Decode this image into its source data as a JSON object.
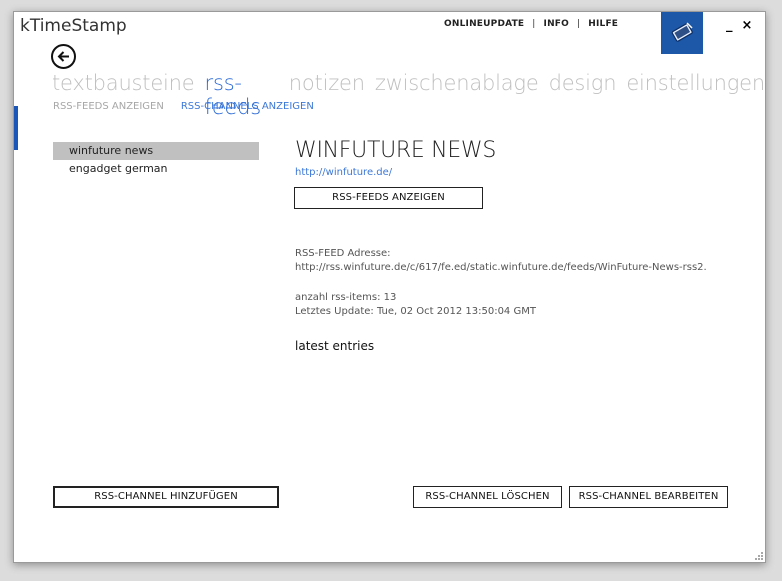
{
  "app": {
    "title": "kTimeStamp"
  },
  "topnav": {
    "onlineupdate": "ONLINEUPDATE",
    "separator": "|",
    "info": "INFO",
    "hilfe": "HILFE"
  },
  "window_controls": {
    "minimize": "_",
    "close": "×"
  },
  "colors": {
    "accent": "#2a6ad6",
    "brand_tile": "#1d57a8",
    "inactive_nav": "#bfbfbf",
    "selected_row": "#c0c0c0"
  },
  "icons": {
    "back": "arrow-left-circle-icon",
    "app": "tablet-pen-icon"
  },
  "mainnav": {
    "items": [
      "textbausteine",
      "rss-feeds",
      "notizen",
      "zwischenablage",
      "design",
      "einstellungen"
    ],
    "active": "rss-feeds"
  },
  "subnav": {
    "feeds": "RSS-FEEDS ANZEIGEN",
    "channels": "RSS-CHANNELS ANZEIGEN",
    "active": "RSS-CHANNELS ANZEIGEN"
  },
  "channels": [
    {
      "label": "winfuture news",
      "selected": true
    },
    {
      "label": "engadget german",
      "selected": false
    }
  ],
  "detail": {
    "title": "WINFUTURE NEWS",
    "url": "http://winfuture.de/",
    "show_feeds_button": "RSS-FEEDS ANZEIGEN",
    "feed_address_label": "RSS-FEED Adresse:",
    "feed_address": "http://rss.winfuture.de/c/617/fe.ed/static.winfuture.de/feeds/WinFuture-News-rss2.",
    "items_count": "anzahl rss-items: 13",
    "last_update": "Letztes Update: Tue, 02 Oct 2012 13:50:04 GMT",
    "latest_entries": "latest entries"
  },
  "footer_buttons": {
    "add": "RSS-CHANNEL HINZUFÜGEN",
    "delete": "RSS-CHANNEL LÖSCHEN",
    "edit": "RSS-CHANNEL BEARBEITEN"
  }
}
